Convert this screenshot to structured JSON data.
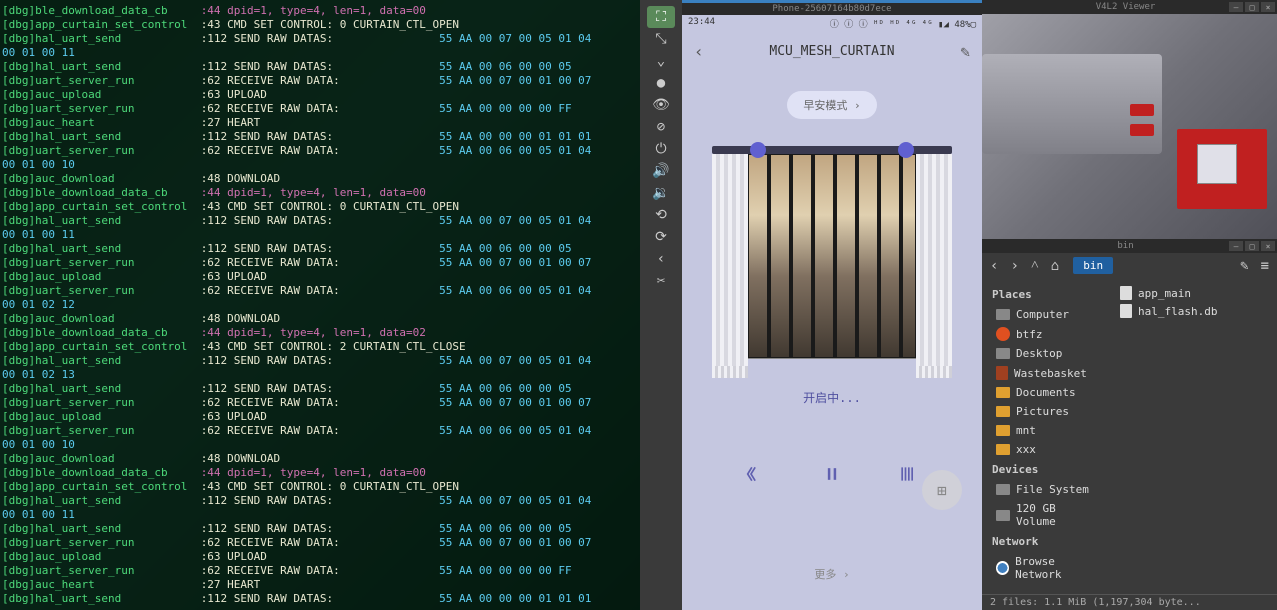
{
  "terminal": {
    "lines": [
      {
        "tag": "[dbg]ble_download_data_cb",
        "cmd": "",
        "hex": "",
        "magenta": ":44 dpid=1, type=4, len=1, data=00"
      },
      {
        "tag": "[dbg]app_curtain_set_control",
        "cmd": ":43 CMD SET CONTROL: 0 CURTAIN_CTL_OPEN",
        "hex": ""
      },
      {
        "tag": "[dbg]hal_uart_send",
        "cmd": ":112 SEND RAW DATAS:",
        "hex": "55 AA 00 07 00 05 01 04 00 01 00 11"
      },
      {
        "tag": "[dbg]hal_uart_send",
        "cmd": ":112 SEND RAW DATAS:",
        "hex": "55 AA 00 06 00 00 05"
      },
      {
        "tag": "[dbg]uart_server_run",
        "cmd": ":62 RECEIVE RAW DATA:",
        "hex": "55 AA 00 07 00 01 00 07"
      },
      {
        "tag": "[dbg]auc_upload",
        "cmd": ":63 UPLOAD",
        "hex": ""
      },
      {
        "tag": "[dbg]uart_server_run",
        "cmd": ":62 RECEIVE RAW DATA:",
        "hex": "55 AA 00 00 00 00 FF"
      },
      {
        "tag": "[dbg]auc_heart",
        "cmd": ":27 HEART",
        "hex": ""
      },
      {
        "tag": "[dbg]hal_uart_send",
        "cmd": ":112 SEND RAW DATAS:",
        "hex": "55 AA 00 00 00 01 01 01"
      },
      {
        "tag": "[dbg]uart_server_run",
        "cmd": ":62 RECEIVE RAW DATA:",
        "hex": "55 AA 00 06 00 05 01 04 00 01 00 10"
      },
      {
        "tag": "[dbg]auc_download",
        "cmd": ":48 DOWNLOAD",
        "hex": ""
      },
      {
        "tag": "[dbg]ble_download_data_cb",
        "cmd": "",
        "hex": "",
        "magenta": ":44 dpid=1, type=4, len=1, data=00"
      },
      {
        "tag": "[dbg]app_curtain_set_control",
        "cmd": ":43 CMD SET CONTROL: 0 CURTAIN_CTL_OPEN",
        "hex": ""
      },
      {
        "tag": "[dbg]hal_uart_send",
        "cmd": ":112 SEND RAW DATAS:",
        "hex": "55 AA 00 07 00 05 01 04 00 01 00 11"
      },
      {
        "tag": "[dbg]hal_uart_send",
        "cmd": ":112 SEND RAW DATAS:",
        "hex": "55 AA 00 06 00 00 05"
      },
      {
        "tag": "[dbg]uart_server_run",
        "cmd": ":62 RECEIVE RAW DATA:",
        "hex": "55 AA 00 07 00 01 00 07"
      },
      {
        "tag": "[dbg]auc_upload",
        "cmd": ":63 UPLOAD",
        "hex": ""
      },
      {
        "tag": "[dbg]uart_server_run",
        "cmd": ":62 RECEIVE RAW DATA:",
        "hex": "55 AA 00 06 00 05 01 04 00 01 02 12"
      },
      {
        "tag": "[dbg]auc_download",
        "cmd": ":48 DOWNLOAD",
        "hex": ""
      },
      {
        "tag": "[dbg]ble_download_data_cb",
        "cmd": "",
        "hex": "",
        "magenta": ":44 dpid=1, type=4, len=1, data=02"
      },
      {
        "tag": "[dbg]app_curtain_set_control",
        "cmd": ":43 CMD SET CONTROL: 2 CURTAIN_CTL_CLOSE",
        "hex": ""
      },
      {
        "tag": "[dbg]hal_uart_send",
        "cmd": ":112 SEND RAW DATAS:",
        "hex": "55 AA 00 07 00 05 01 04 00 01 02 13"
      },
      {
        "tag": "[dbg]hal_uart_send",
        "cmd": ":112 SEND RAW DATAS:",
        "hex": "55 AA 00 06 00 00 05"
      },
      {
        "tag": "[dbg]uart_server_run",
        "cmd": ":62 RECEIVE RAW DATA:",
        "hex": "55 AA 00 07 00 01 00 07"
      },
      {
        "tag": "[dbg]auc_upload",
        "cmd": ":63 UPLOAD",
        "hex": ""
      },
      {
        "tag": "[dbg]uart_server_run",
        "cmd": ":62 RECEIVE RAW DATA:",
        "hex": "55 AA 00 06 00 05 01 04 00 01 00 10"
      },
      {
        "tag": "[dbg]auc_download",
        "cmd": ":48 DOWNLOAD",
        "hex": ""
      },
      {
        "tag": "[dbg]ble_download_data_cb",
        "cmd": "",
        "hex": "",
        "magenta": ":44 dpid=1, type=4, len=1, data=00"
      },
      {
        "tag": "[dbg]app_curtain_set_control",
        "cmd": ":43 CMD SET CONTROL: 0 CURTAIN_CTL_OPEN",
        "hex": ""
      },
      {
        "tag": "[dbg]hal_uart_send",
        "cmd": ":112 SEND RAW DATAS:",
        "hex": "55 AA 00 07 00 05 01 04 00 01 00 11"
      },
      {
        "tag": "[dbg]hal_uart_send",
        "cmd": ":112 SEND RAW DATAS:",
        "hex": "55 AA 00 06 00 00 05"
      },
      {
        "tag": "[dbg]uart_server_run",
        "cmd": ":62 RECEIVE RAW DATA:",
        "hex": "55 AA 00 07 00 01 00 07"
      },
      {
        "tag": "[dbg]auc_upload",
        "cmd": ":63 UPLOAD",
        "hex": ""
      },
      {
        "tag": "[dbg]uart_server_run",
        "cmd": ":62 RECEIVE RAW DATA:",
        "hex": "55 AA 00 00 00 00 FF"
      },
      {
        "tag": "[dbg]auc_heart",
        "cmd": ":27 HEART",
        "hex": ""
      },
      {
        "tag": "[dbg]hal_uart_send",
        "cmd": ":112 SEND RAW DATAS:",
        "hex": "55 AA 00 00 00 01 01 01"
      }
    ]
  },
  "sidebar": {
    "icons": [
      "⛶",
      "⤡",
      "⌄",
      "●",
      "👁",
      "⊘",
      "⏻",
      "🔊",
      "🔉",
      "⟲",
      "⟳",
      "‹",
      "✂"
    ]
  },
  "phone": {
    "window_title": "Phone-25607164b80d7ece",
    "status_time": "23:44",
    "status_right": "ⓘ ⓘ ⓘ ᴴᴰ ᴴᴰ ⁴ᴳ ⁴ᴳ ▮◢ 48%▢",
    "app_title": "MCU_MESH_CURTAIN",
    "mode_badge": "早安模式 ›",
    "status_text": "开启中...",
    "more_link": "更多 ›"
  },
  "viewer": {
    "title": "V4L2 Viewer"
  },
  "filemanager": {
    "title": "bin",
    "path": "bin",
    "places_header": "Places",
    "devices_header": "Devices",
    "network_header": "Network",
    "places": [
      {
        "icon": "comp",
        "label": "Computer"
      },
      {
        "icon": "fire",
        "label": "btfz"
      },
      {
        "icon": "comp",
        "label": "Desktop"
      },
      {
        "icon": "trash",
        "label": "Wastebasket"
      },
      {
        "icon": "folder",
        "label": "Documents"
      },
      {
        "icon": "folder",
        "label": "Pictures"
      },
      {
        "icon": "folder",
        "label": "mnt"
      },
      {
        "icon": "folder",
        "label": "xxx"
      }
    ],
    "devices": [
      {
        "icon": "comp",
        "label": "File System"
      },
      {
        "icon": "comp",
        "label": "120 GB Volume"
      }
    ],
    "network": [
      {
        "icon": "net",
        "label": "Browse Network"
      }
    ],
    "files": [
      {
        "name": "app_main"
      },
      {
        "name": "hal_flash.db"
      }
    ],
    "status": "2 files: 1.1 MiB (1,197,304 byte..."
  }
}
